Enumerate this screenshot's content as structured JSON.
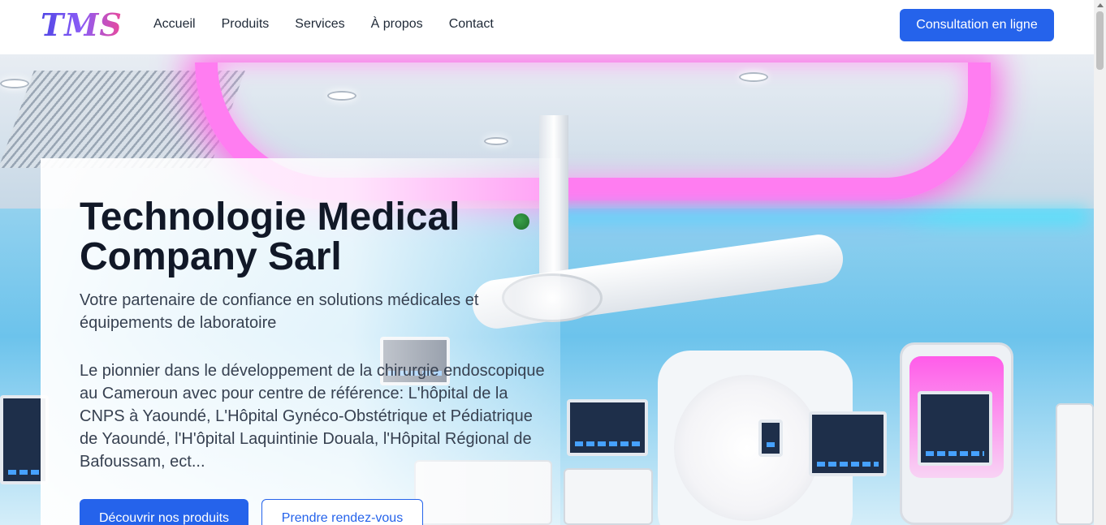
{
  "header": {
    "logo": "TMS",
    "nav": [
      "Accueil",
      "Produits",
      "Services",
      "À propos",
      "Contact"
    ],
    "cta_label": "Consultation en ligne"
  },
  "hero": {
    "title": "Technologie Medical Company Sarl",
    "subtitle": "Votre partenaire de confiance en solutions médicales et équipements de laboratoire",
    "description": "Le pionnier dans le développement de la chirurgie endoscopique au Cameroun avec pour centre de référence: L'hôpital de la CNPS à Yaoundé, L'Hôpital Gynéco-Obstétrique et Pédiatrique de Yaoundé, l'H'ôpital Laquintinie Douala, l'Hôpital Régional de Bafoussam, ect...",
    "primary_button": "Découvrir nos produits",
    "secondary_button": "Prendre rendez-vous"
  },
  "colors": {
    "accent": "#2563eb",
    "logo_gradient": [
      "#4f46e5",
      "#ec4899"
    ],
    "neon": "#ff6ae8"
  }
}
